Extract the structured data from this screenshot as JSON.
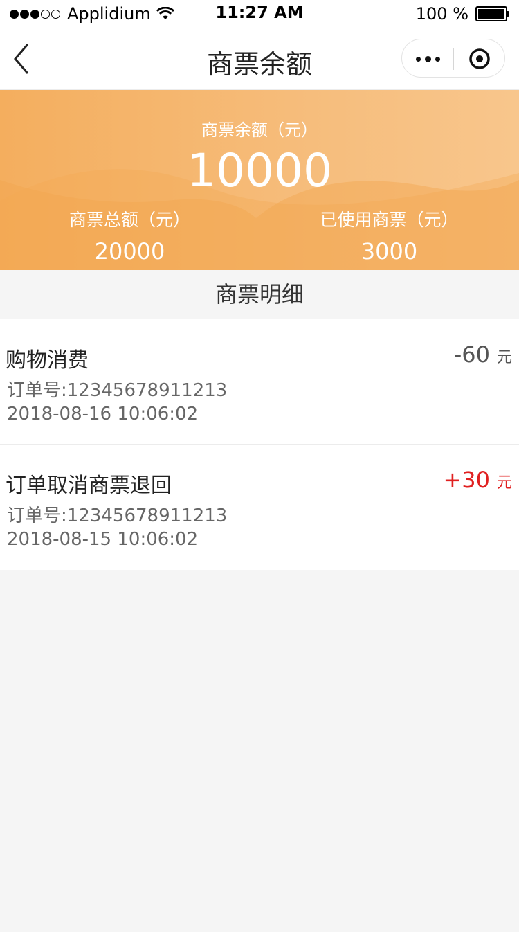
{
  "status_bar": {
    "carrier": "Applidium",
    "time": "11:27 AM",
    "battery": "100 %"
  },
  "nav": {
    "title": "商票余额"
  },
  "summary": {
    "balance_label": "商票余额（元）",
    "balance": "10000",
    "total_label": "商票总额（元）",
    "total": "20000",
    "used_label": "已使用商票（元）",
    "used": "3000"
  },
  "section": {
    "title": "商票明细"
  },
  "records": [
    {
      "title": "购物消费",
      "order": "订单号:12345678911213",
      "time": "2018-08-16 10:06:02",
      "amount": "-60",
      "unit": "元"
    },
    {
      "title": "订单取消商票退回",
      "order": "订单号:12345678911213",
      "time": "2018-08-15 10:06:02",
      "amount": "+30",
      "unit": "元"
    }
  ],
  "colors": {
    "banner": "#f4ae5e",
    "positive_amount": "#e02020",
    "negative_amount": "#555555"
  }
}
